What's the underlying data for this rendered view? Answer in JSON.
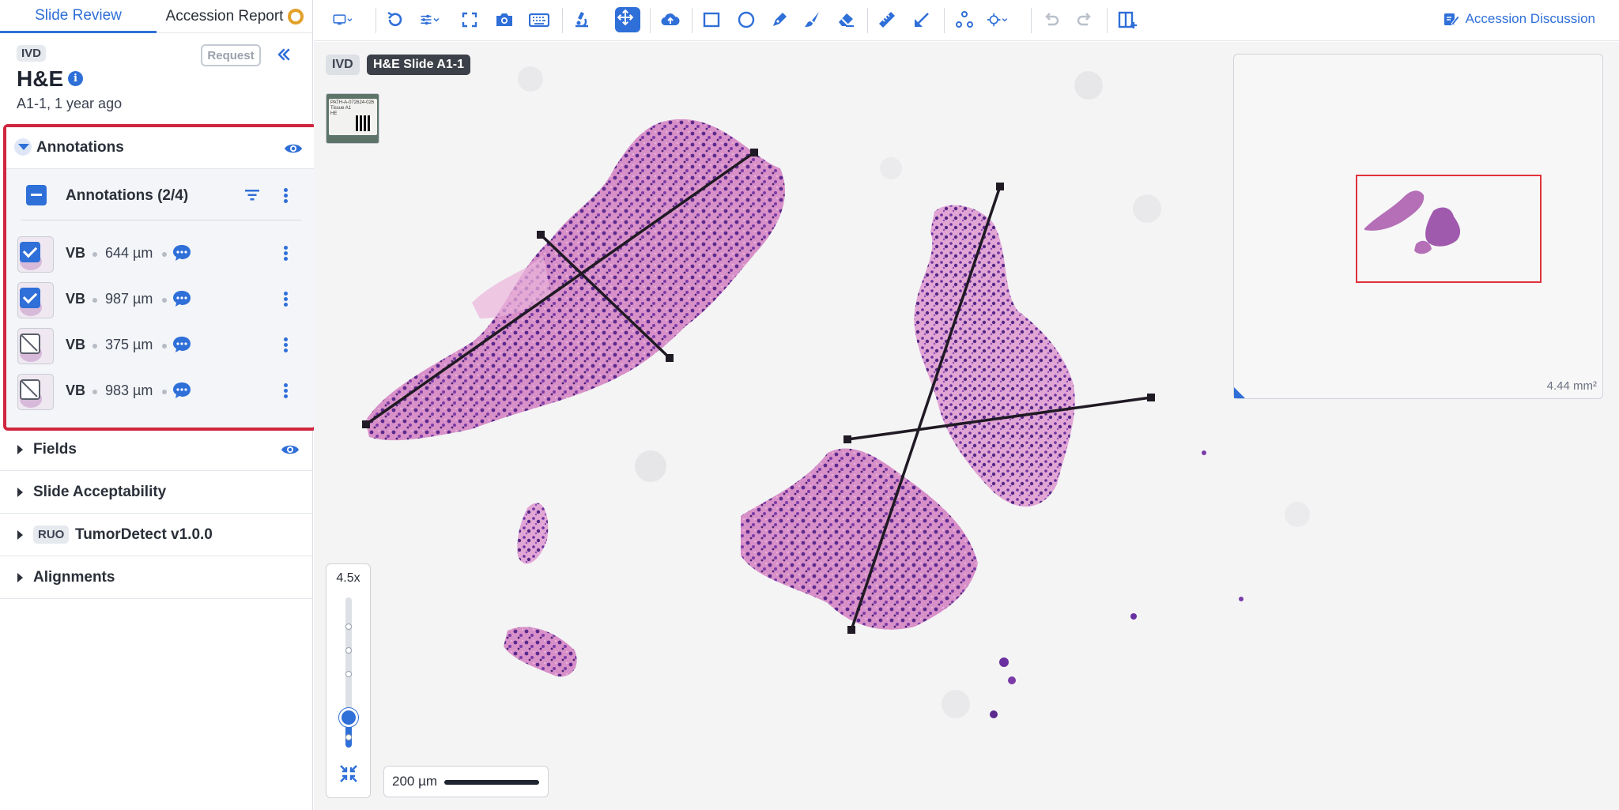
{
  "tabs": {
    "slide_review": "Slide Review",
    "accession_report": "Accession Report"
  },
  "slide": {
    "badge": "IVD",
    "request_label": "Request",
    "title": "H&E",
    "meta": "A1-1, 1 year ago"
  },
  "annotations": {
    "title": "Annotations",
    "group_label": "Annotations (2/4)",
    "items": [
      {
        "name": "VB",
        "length": "644 µm",
        "checked": true
      },
      {
        "name": "VB",
        "length": "987 µm",
        "checked": true
      },
      {
        "name": "VB",
        "length": "375 µm",
        "checked": false
      },
      {
        "name": "VB",
        "length": "983 µm",
        "checked": false
      }
    ]
  },
  "sections": [
    {
      "label": "Fields"
    },
    {
      "label": "Slide Acceptability"
    },
    {
      "badge": "RUO",
      "label": "TumorDetect v1.0.0"
    },
    {
      "label": "Alignments"
    }
  ],
  "toolbar": {
    "discussion_label": "Accession Discussion",
    "icons": [
      "monitor-icon",
      "rotate-icon",
      "adjust-icon",
      "fullscreen-icon",
      "camera-icon",
      "keyboard-icon",
      "microscope-icon",
      "pan-icon",
      "cloud-upload-icon",
      "rectangle-icon",
      "ellipse-icon",
      "pen-icon",
      "brush-icon",
      "eraser-icon",
      "ruler-icon",
      "arrow-icon",
      "points-icon",
      "crosshair-icon",
      "undo-icon",
      "redo-icon",
      "layout-icon"
    ]
  },
  "viewer": {
    "badge": "IVD",
    "slide_name": "H&E Slide A1-1",
    "label_text": "PATH-A-072624-026\nTissue A1\nHE",
    "minimap_area": "4.44 mm²",
    "zoom_level": "4.5x",
    "scale_label": "200 µm"
  },
  "colors": {
    "accent": "#2f6fd8",
    "highlight_border": "#d0263f",
    "minimap_viewport": "#e0323a",
    "measure_line": "#1f1a24",
    "stain_pink": "#d98fcb",
    "stain_purple": "#5b2a8e"
  }
}
